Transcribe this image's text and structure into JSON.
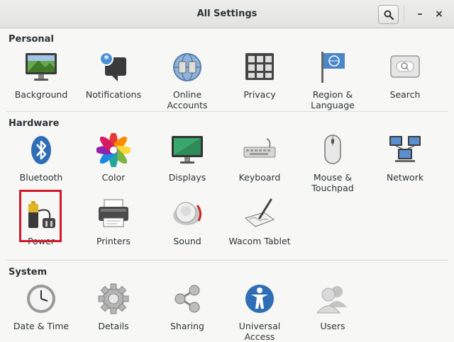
{
  "window": {
    "title": "All Settings"
  },
  "titlebar": {
    "search_icon": "search-icon",
    "minimize_glyph": "–",
    "close_glyph": "×"
  },
  "sections": {
    "personal": {
      "title": "Personal",
      "items": [
        {
          "label": "Background"
        },
        {
          "label": "Notifications"
        },
        {
          "label": "Online\nAccounts"
        },
        {
          "label": "Privacy"
        },
        {
          "label": "Region &\nLanguage"
        },
        {
          "label": "Search"
        }
      ]
    },
    "hardware": {
      "title": "Hardware",
      "items": [
        {
          "label": "Bluetooth"
        },
        {
          "label": "Color"
        },
        {
          "label": "Displays"
        },
        {
          "label": "Keyboard"
        },
        {
          "label": "Mouse &\nTouchpad"
        },
        {
          "label": "Network"
        },
        {
          "label": "Power"
        },
        {
          "label": "Printers"
        },
        {
          "label": "Sound"
        },
        {
          "label": "Wacom Tablet"
        }
      ]
    },
    "system": {
      "title": "System",
      "items": [
        {
          "label": "Date & Time"
        },
        {
          "label": "Details"
        },
        {
          "label": "Sharing"
        },
        {
          "label": "Universal\nAccess"
        },
        {
          "label": "Users"
        }
      ]
    }
  },
  "colors": {
    "highlight": "#d2182b",
    "accent": "#3a6fb0"
  }
}
